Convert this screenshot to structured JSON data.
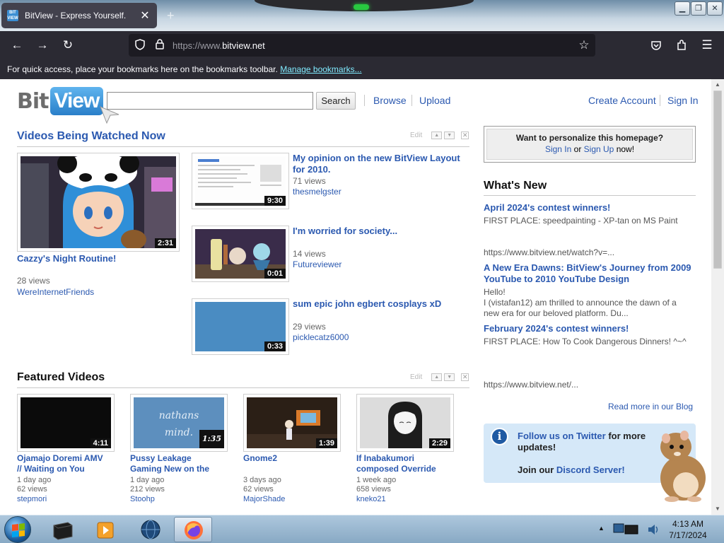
{
  "browser": {
    "tab_title": "BitView - Express Yourself.",
    "tab_close": "✕",
    "new_tab": "+",
    "url_prefix": "https://www.",
    "url_domain": "bitview.net",
    "bookmarks_text": "For quick access, place your bookmarks here on the bookmarks toolbar.",
    "bookmarks_link": "Manage bookmarks..."
  },
  "header": {
    "logo_left": "Bit",
    "logo_right": "View",
    "search_button": "Search",
    "browse": "Browse",
    "upload": "Upload",
    "create_account": "Create Account",
    "sign_in": "Sign In"
  },
  "watched": {
    "title": "Videos Being Watched Now",
    "edit": "Edit",
    "main": {
      "title": "Cazzy's Night Routine!",
      "views": "28 views",
      "user": "WereInternetFriends",
      "duration": "2:31"
    },
    "items": [
      {
        "title": "My opinion on the new BitView Layout for 2010.",
        "views": "71 views",
        "user": "thesmelgster",
        "duration": "9:30"
      },
      {
        "title": "I'm worried for society...",
        "views": "14 views",
        "user": "Futureviewer",
        "duration": "0:01"
      },
      {
        "title": "sum epic john egbert cosplays xD",
        "views": "29 views",
        "user": "picklecatz6000",
        "duration": "0:33"
      }
    ]
  },
  "featured": {
    "title": "Featured Videos",
    "edit": "Edit",
    "items": [
      {
        "title": "Ojamajo Doremi AMV // Waiting on You",
        "age": "1 day ago",
        "views": "62 views",
        "user": "stepmori",
        "duration": "4:11"
      },
      {
        "title": "Pussy Leakage Gaming New on the",
        "age": "1 day ago",
        "views": "212 views",
        "user": "Stoohp",
        "duration": "1:35",
        "thumb_text_1": "nathans",
        "thumb_text_2": "mind."
      },
      {
        "title": "Gnome2",
        "age": "3 days ago",
        "views": "62 views",
        "user": "MajorShade",
        "duration": "1:39"
      },
      {
        "title": "If Inabakumori composed Override",
        "age": "1 week ago",
        "views": "658 views",
        "user": "kneko21",
        "duration": "2:29"
      }
    ]
  },
  "sidebar": {
    "personalize_q": "Want to personalize this homepage?",
    "sign_in": "Sign In",
    "or": "or",
    "sign_up": "Sign Up",
    "now": "now!",
    "whats_new": "What's New",
    "news": [
      {
        "title": "April 2024's contest winners!",
        "body": "FIRST PLACE: speedpainting - XP-tan on MS Paint",
        "extra": "https://www.bitview.net/watch?v=..."
      },
      {
        "title": "A New Era Dawns: BitView's Journey from 2009 YouTube to 2010 YouTube Design",
        "body": "Hello!",
        "body2": "I (vistafan12) am thrilled to announce the dawn of a new era for our beloved platform. Du..."
      },
      {
        "title": "February 2024's contest winners!",
        "body": "FIRST PLACE: How To Cook Dangerous Dinners! ^~^",
        "extra": "https://www.bitview.net/..."
      }
    ],
    "read_more": "Read more in our Blog",
    "follow": "Follow us on Twitter",
    "follow_rest": "for more",
    "follow_rest2": "updates!",
    "join": "Join our",
    "discord": "Discord Server!"
  },
  "taskbar": {
    "time": "4:13 AM",
    "date": "7/17/2024"
  }
}
